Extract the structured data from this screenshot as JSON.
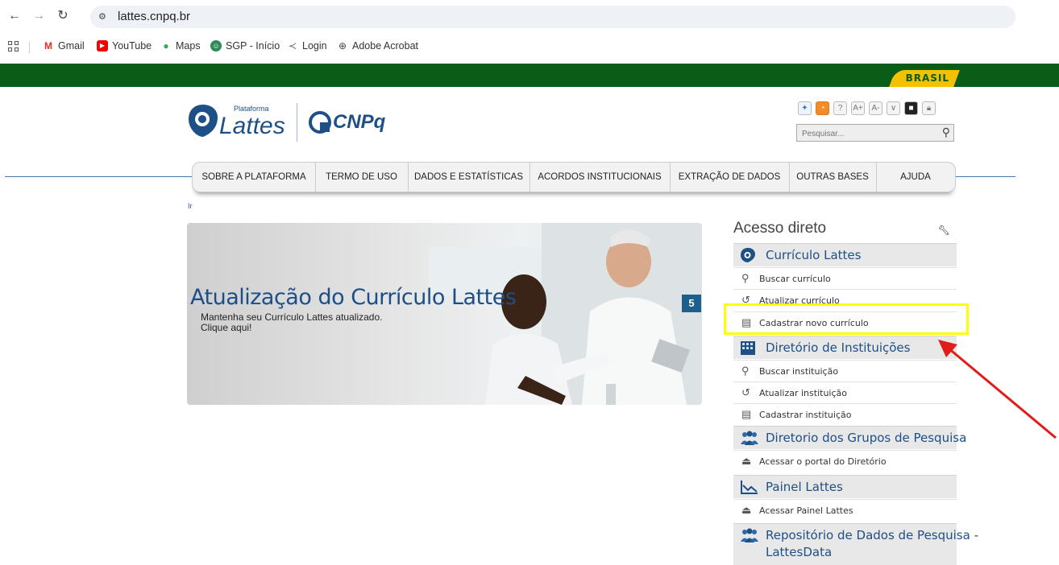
{
  "browser": {
    "url": "lattes.cnpq.br",
    "bookmarks": [
      {
        "label": "Gmail",
        "icon": "gmail-icon"
      },
      {
        "label": "YouTube",
        "icon": "youtube-icon"
      },
      {
        "label": "Maps",
        "icon": "maps-icon"
      },
      {
        "label": "SGP - Início",
        "icon": "sgp-icon"
      },
      {
        "label": "Login",
        "icon": "login-icon"
      },
      {
        "label": "Adobe Acrobat",
        "icon": "acrobat-icon"
      }
    ]
  },
  "gov_bar": {
    "label": "BRASIL"
  },
  "header": {
    "lattes_small": "Plataforma",
    "lattes_big": "Lattes",
    "cnpq": "CNPq",
    "search_placeholder": "Pesquisar..."
  },
  "menu": [
    "SOBRE A PLATAFORMA",
    "TERMO DE USO",
    "DADOS E ESTATÍSTICAS",
    "ACORDOS INSTITUCIONAIS",
    "EXTRAÇÃO DE DADOS",
    "OUTRAS BASES",
    "AJUDA"
  ],
  "skip_link": "Ir",
  "banner": {
    "title": "Atualização do Currículo Lattes",
    "line1": "Mantenha seu Currículo Lattes atualizado.",
    "line2": "Clique aqui!",
    "badge": "5"
  },
  "sidebar": {
    "title": "Acesso direto",
    "sections": [
      {
        "label": "Currículo Lattes",
        "icon": "lattes-icon",
        "items": [
          {
            "label": "Buscar currículo",
            "icon": "search-icon"
          },
          {
            "label": "Atualizar currículo",
            "icon": "refresh-icon"
          },
          {
            "label": "Cadastrar novo currículo",
            "icon": "form-icon"
          }
        ]
      },
      {
        "label": "Diretório de Instituições",
        "icon": "building-icon",
        "items": [
          {
            "label": "Buscar instituição",
            "icon": "search-icon"
          },
          {
            "label": "Atualizar instituição",
            "icon": "refresh-icon"
          },
          {
            "label": "Cadastrar instituição",
            "icon": "form-icon"
          }
        ]
      },
      {
        "label": "Diretorio dos Grupos de Pesquisa",
        "icon": "group-icon",
        "items": [
          {
            "label": "Acessar o portal do Diretório",
            "icon": "mouse-icon"
          }
        ]
      },
      {
        "label": "Painel Lattes",
        "icon": "chart-line-icon",
        "items": [
          {
            "label": "Acessar Painel Lattes",
            "icon": "mouse-icon"
          }
        ]
      },
      {
        "label": "Repositório de Dados de Pesquisa -",
        "label2": "LattesData",
        "icon": "group-icon",
        "items": []
      }
    ]
  }
}
